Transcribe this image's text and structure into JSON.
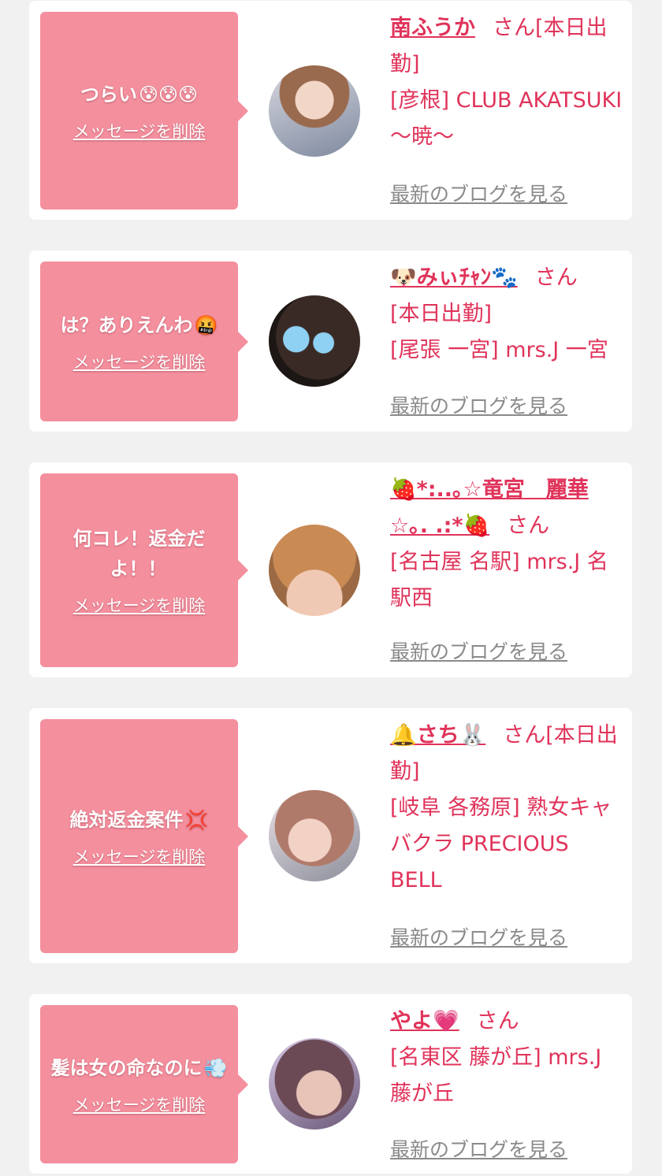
{
  "delete_label": "メッセージを削除",
  "blog_label": "最新のブログを見る",
  "san_suffix": "さん",
  "colors": {
    "accent": "#e0335a",
    "bubble": "#f48f9e",
    "background": "#f1f1f1"
  },
  "cards": [
    {
      "message": "つらい",
      "message_emoji": "😰😰😰",
      "name": "南ふうか",
      "status": "[本日出勤]",
      "shop": "[彦根] CLUB AKATSUKI 〜暁〜"
    },
    {
      "message": "は？ありえんわ",
      "message_emoji": "🤬",
      "name": "🐶みぃﾁｬﾝ🐾",
      "status": "[本日出勤]",
      "shop": "[尾張 一宮] mrs.J 一宮"
    },
    {
      "message": "何コレ！返金だよ！！",
      "message_emoji": "",
      "name": "🍓*:..｡☆竜宮　麗華☆｡. .:*🍓",
      "status": "",
      "shop": "[名古屋 名駅] mrs.J 名駅西"
    },
    {
      "message": "絶対返金案件",
      "message_emoji": "💢",
      "name": "🔔さち🐰",
      "status": "[本日出勤]",
      "shop": "[岐阜 各務原] 熟女キャバクラ PRECIOUS BELL"
    },
    {
      "message": "髪は女の命なのに",
      "message_emoji": "💨",
      "name": "やよ💗",
      "status": "",
      "shop": "[名東区 藤が丘] mrs.J 藤が丘"
    }
  ]
}
